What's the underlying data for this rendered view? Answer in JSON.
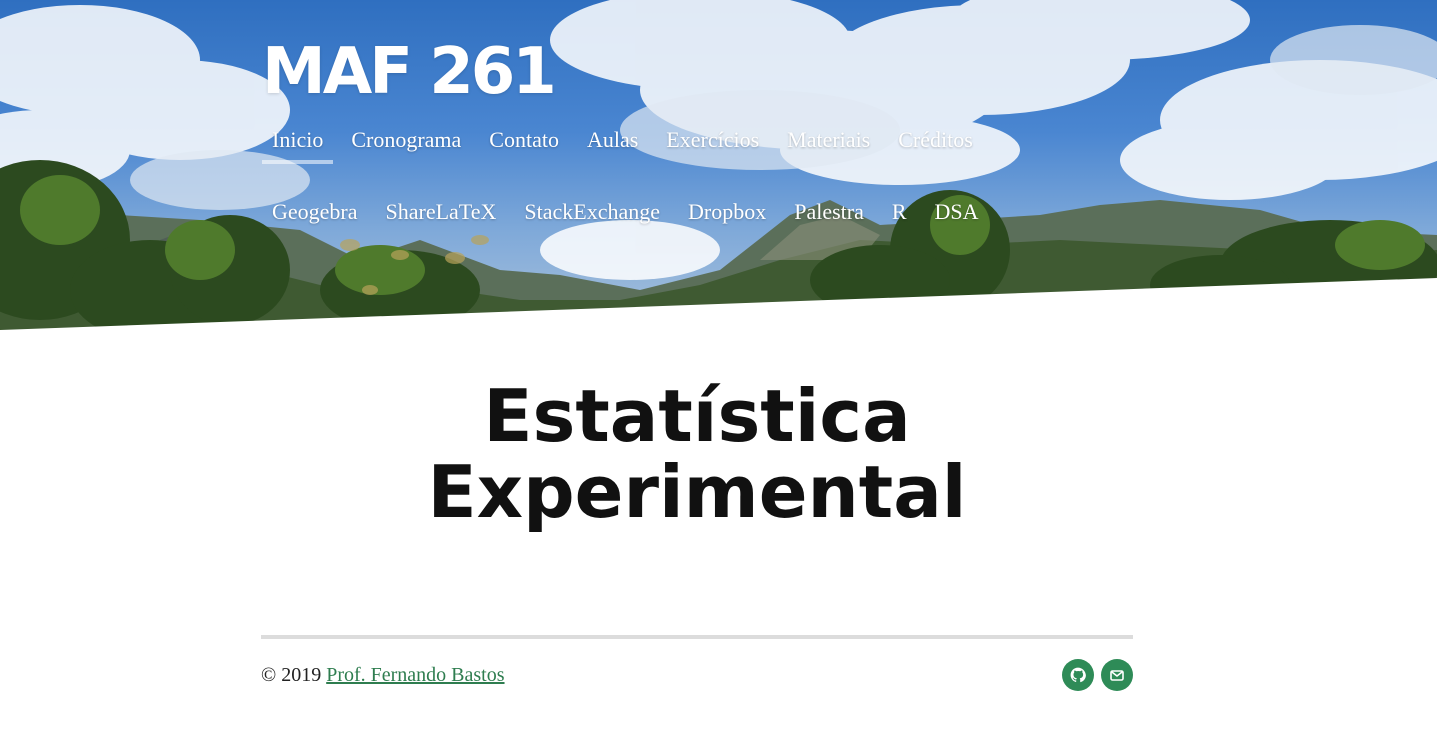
{
  "header": {
    "site_title": "MAF 261",
    "nav_row1": [
      {
        "label": "Inicio",
        "active": true
      },
      {
        "label": "Cronograma",
        "active": false
      },
      {
        "label": "Contato",
        "active": false
      },
      {
        "label": "Aulas",
        "active": false
      },
      {
        "label": "Exercícios",
        "active": false
      },
      {
        "label": "Materiais",
        "active": false
      },
      {
        "label": "Créditos",
        "active": false
      }
    ],
    "nav_row2": [
      {
        "label": "Geogebra"
      },
      {
        "label": "ShareLaTeX"
      },
      {
        "label": "StackExchange"
      },
      {
        "label": "Dropbox"
      },
      {
        "label": "Palestra"
      },
      {
        "label": "R"
      },
      {
        "label": "DSA"
      }
    ]
  },
  "main": {
    "title_line1": "Estatística",
    "title_line2": "Experimental"
  },
  "footer": {
    "copyright": "© 2019",
    "author_link": "Prof. Fernando Bastos",
    "icons": [
      "github-icon",
      "mail-icon"
    ]
  },
  "colors": {
    "accent_green": "#2e8b57",
    "link_green": "#2e7d4f",
    "heading": "#111111"
  }
}
